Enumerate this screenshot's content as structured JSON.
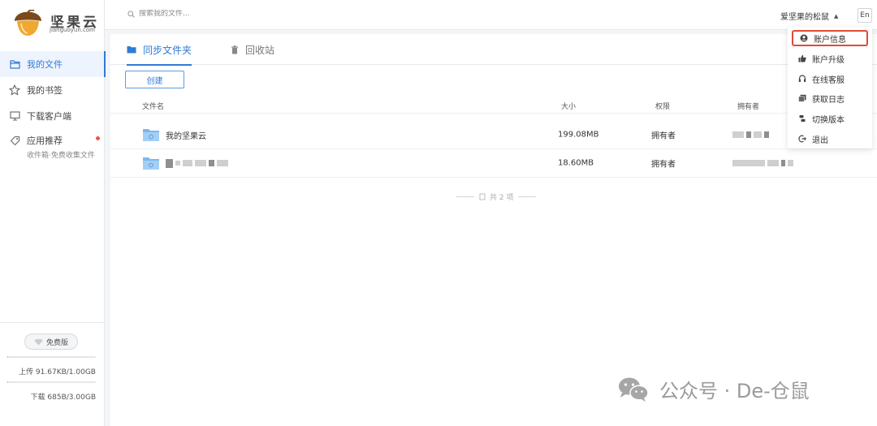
{
  "brand": {
    "name_cn": "坚果云",
    "name_en": "jianguoyun.com"
  },
  "sidebar": {
    "items": [
      {
        "label": "我的文件"
      },
      {
        "label": "我的书签"
      },
      {
        "label": "下载客户端"
      },
      {
        "label": "应用推荐",
        "sub": "收件箱·免费收集文件"
      }
    ],
    "plan": "免费版",
    "upload": {
      "text": "上传 91.67KB/1.00GB",
      "fraction": 0.0001
    },
    "download": {
      "text": "下载 685B/3.00GB",
      "fraction": 2e-07
    }
  },
  "topbar": {
    "search_placeholder": "搜索我的文件...",
    "user": "爱坚果的松鼠",
    "lang": "En"
  },
  "tabs": [
    {
      "label": "同步文件夹"
    },
    {
      "label": "回收站"
    }
  ],
  "toolbar": {
    "create_label": "创建"
  },
  "table": {
    "headers": {
      "name": "文件名",
      "size": "大小",
      "permission": "权限",
      "owner": "拥有者"
    },
    "rows": [
      {
        "name": "我的坚果云",
        "size": "199.08MB",
        "permission": "拥有者"
      },
      {
        "name": "",
        "size": "18.60MB",
        "permission": "拥有者"
      }
    ],
    "total": "共 2 项"
  },
  "dropdown": {
    "items": [
      {
        "label": "账户信息",
        "icon": "user-circle-icon"
      },
      {
        "label": "账户升级",
        "icon": "thumbs-up-icon"
      },
      {
        "label": "在线客服",
        "icon": "headset-icon"
      },
      {
        "label": "获取日志",
        "icon": "log-icon"
      },
      {
        "label": "切换版本",
        "icon": "switch-icon"
      },
      {
        "label": "退出",
        "icon": "logout-icon"
      }
    ]
  },
  "colors": {
    "accent": "#2f7bd6",
    "highlight_border": "#e04b36",
    "folder": "#7db8ee",
    "badge_dot": "#f05252"
  },
  "watermark": {
    "text": "公众号 · De-仓鼠"
  }
}
